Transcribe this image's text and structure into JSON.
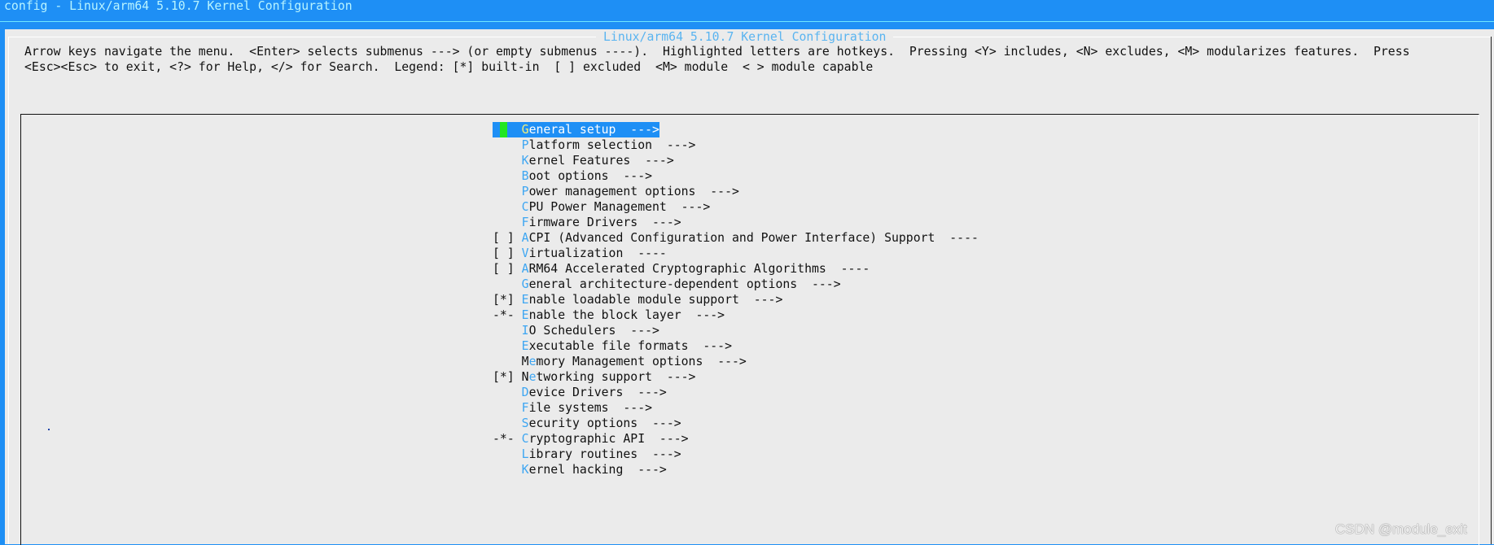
{
  "window": {
    "title": "config - Linux/arm64 5.10.7 Kernel Configuration"
  },
  "dialog": {
    "title": "Linux/arm64 5.10.7 Kernel Configuration",
    "help_lines": [
      "Arrow keys navigate the menu.  <Enter> selects submenus ---> (or empty submenus ----).  Highlighted letters are hotkeys.  Pressing <Y> includes, <N> excludes, <M> modularizes features.  Press",
      "<Esc><Esc> to exit, <?> for Help, </> for Search.  Legend: [*] built-in  [ ] excluded  <M> module  < > module capable"
    ]
  },
  "colors": {
    "background": "#1e8ff5",
    "panel": "#ebebeb",
    "hotkey": "#3ea6f2",
    "selected_hotkey": "#f5f07a",
    "cursor": "#22e622"
  },
  "menu": {
    "selected_index": 0,
    "items": [
      {
        "prefix": "    ",
        "pre": "",
        "hot": "G",
        "post": "eneral setup  --->"
      },
      {
        "prefix": "    ",
        "pre": "",
        "hot": "P",
        "post": "latform selection  --->"
      },
      {
        "prefix": "    ",
        "pre": "",
        "hot": "K",
        "post": "ernel Features  --->"
      },
      {
        "prefix": "    ",
        "pre": "",
        "hot": "B",
        "post": "oot options  --->"
      },
      {
        "prefix": "    ",
        "pre": "",
        "hot": "P",
        "post": "ower management options  --->"
      },
      {
        "prefix": "    ",
        "pre": "",
        "hot": "C",
        "post": "PU Power Management  --->"
      },
      {
        "prefix": "    ",
        "pre": "",
        "hot": "F",
        "post": "irmware Drivers  --->"
      },
      {
        "prefix": "[ ] ",
        "pre": "",
        "hot": "A",
        "post": "CPI (Advanced Configuration and Power Interface) Support  ----"
      },
      {
        "prefix": "[ ] ",
        "pre": "",
        "hot": "V",
        "post": "irtualization  ----"
      },
      {
        "prefix": "[ ] ",
        "pre": "",
        "hot": "A",
        "post": "RM64 Accelerated Cryptographic Algorithms  ----"
      },
      {
        "prefix": "    ",
        "pre": "",
        "hot": "G",
        "post": "eneral architecture-dependent options  --->"
      },
      {
        "prefix": "[*] ",
        "pre": "",
        "hot": "E",
        "post": "nable loadable module support  --->"
      },
      {
        "prefix": "-*- ",
        "pre": "",
        "hot": "E",
        "post": "nable the block layer  --->"
      },
      {
        "prefix": "    ",
        "pre": "",
        "hot": "I",
        "post": "O Schedulers  --->"
      },
      {
        "prefix": "    ",
        "pre": "",
        "hot": "E",
        "post": "xecutable file formats  --->"
      },
      {
        "prefix": "    ",
        "pre": "M",
        "hot": "e",
        "post": "mory Management options  --->"
      },
      {
        "prefix": "[*] ",
        "pre": "N",
        "hot": "e",
        "post": "tworking support  --->"
      },
      {
        "prefix": "    ",
        "pre": "",
        "hot": "D",
        "post": "evice Drivers  --->"
      },
      {
        "prefix": "    ",
        "pre": "",
        "hot": "F",
        "post": "ile systems  --->"
      },
      {
        "prefix": "    ",
        "pre": "",
        "hot": "S",
        "post": "ecurity options  --->"
      },
      {
        "prefix": "-*- ",
        "pre": "",
        "hot": "C",
        "post": "ryptographic API  --->"
      },
      {
        "prefix": "    ",
        "pre": "",
        "hot": "L",
        "post": "ibrary routines  --->"
      },
      {
        "prefix": "    ",
        "pre": "",
        "hot": "K",
        "post": "ernel hacking  --->"
      }
    ]
  },
  "watermark": "CSDN @module_exit"
}
